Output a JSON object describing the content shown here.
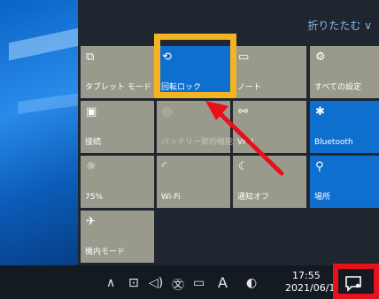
{
  "panel": {
    "collapse_label": "折りたたむ ∨"
  },
  "tiles": [
    {
      "label": "タブレット モード",
      "icon": "tablet-mode-icon",
      "glyph": "⧉",
      "state": "off"
    },
    {
      "label": "回転ロック",
      "icon": "rotation-lock-icon",
      "glyph": "⟲",
      "state": "on"
    },
    {
      "label": "ノート",
      "icon": "note-icon",
      "glyph": "▭",
      "state": "off"
    },
    {
      "label": "すべての設定",
      "icon": "gear-icon",
      "glyph": "⚙",
      "state": "off"
    },
    {
      "label": "接続",
      "icon": "connect-icon",
      "glyph": "▣",
      "state": "off"
    },
    {
      "label": "バッテリー節約機能",
      "icon": "battery-saver-icon",
      "glyph": "◎",
      "state": "disabled"
    },
    {
      "label": "VPN",
      "icon": "vpn-icon",
      "glyph": "⚯",
      "state": "off"
    },
    {
      "label": "Bluetooth",
      "icon": "bluetooth-icon",
      "glyph": "✱",
      "state": "on"
    },
    {
      "label": "75%",
      "icon": "brightness-icon",
      "glyph": "☼",
      "state": "off"
    },
    {
      "label": "Wi-Fi",
      "icon": "wifi-icon",
      "glyph": "◜",
      "state": "off"
    },
    {
      "label": "通知オフ",
      "icon": "moon-icon",
      "glyph": "☾",
      "state": "off"
    },
    {
      "label": "場所",
      "icon": "location-icon",
      "glyph": "⚲",
      "state": "on"
    },
    {
      "label": "機内モード",
      "icon": "airplane-icon",
      "glyph": "✈",
      "state": "off"
    }
  ],
  "taskbar": {
    "tray_glyphs": {
      "chevron": "∧",
      "meet": "⊡",
      "volume": "◁)",
      "ime": "㉆",
      "network": "▭",
      "ime_mode": "A",
      "defender": "◐"
    },
    "time": "17:55",
    "date": "2021/06/1"
  },
  "colors": {
    "tile_on": "#0f6fcf",
    "tile_off": "#9a9a8c",
    "highlight_yellow": "#f3b322",
    "highlight_red": "#e8101b"
  }
}
